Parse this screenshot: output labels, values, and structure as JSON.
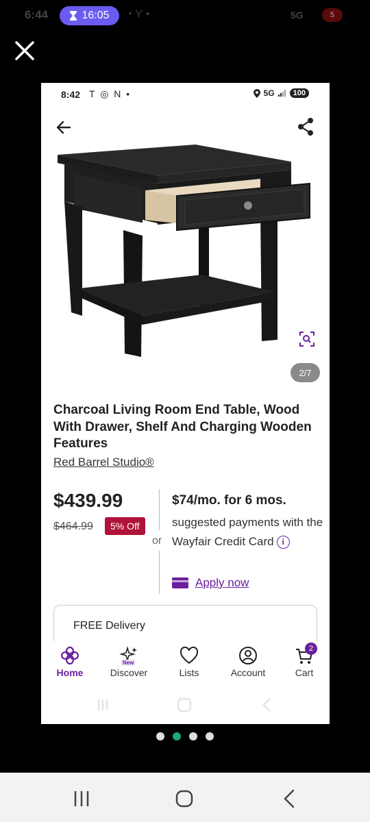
{
  "outer_status": {
    "time": "6:44",
    "timer": "16:05",
    "network": "5G",
    "battery": "5"
  },
  "inner_status": {
    "time": "8:42",
    "notif_icons": "T ◎ N •",
    "network": "5G",
    "battery": "100"
  },
  "product": {
    "image_counter": "2/7",
    "title": "Charcoal Living Room End Table, Wood With Drawer, Shelf And Charging Wooden Features",
    "brand": "Red Barrel Studio®",
    "price": "$439.99",
    "old_price": "$464.99",
    "discount": "5% Off"
  },
  "financing": {
    "or": "or",
    "monthly": "$74/mo. for 6 mos.",
    "description": "suggested payments with the Wayfair Credit Card",
    "apply": "Apply now"
  },
  "delivery": {
    "label": "FREE Delivery"
  },
  "bottom_nav": {
    "items": [
      {
        "label": "Home",
        "icon": "home-icon"
      },
      {
        "label": "Discover",
        "icon": "discover-icon",
        "tag": "New"
      },
      {
        "label": "Lists",
        "icon": "heart-icon"
      },
      {
        "label": "Account",
        "icon": "account-icon"
      },
      {
        "label": "Cart",
        "icon": "cart-icon",
        "badge": "2"
      }
    ]
  },
  "carousel": {
    "active_index": 1,
    "count": 4
  },
  "colors": {
    "brand_purple": "#6b1f9c",
    "discount_red": "#b0133a",
    "timer_pill": "#6a5cf0",
    "active_dot": "#1aa57f"
  }
}
